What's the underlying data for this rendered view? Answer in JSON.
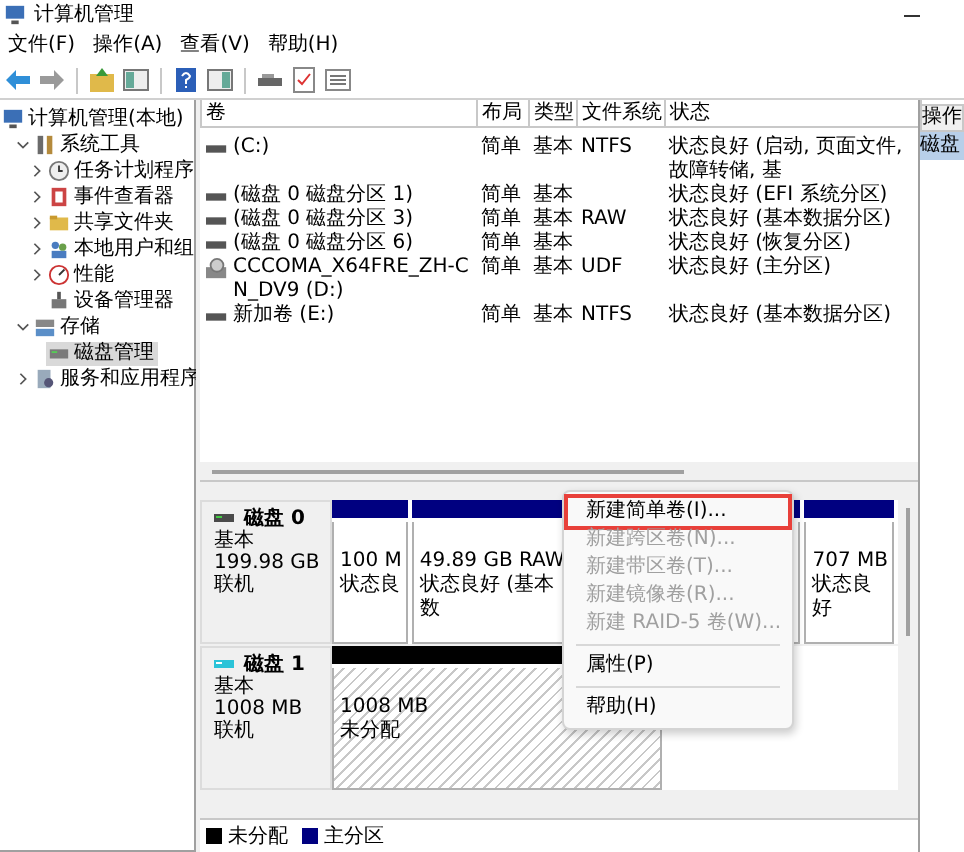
{
  "window": {
    "title": "计算机管理"
  },
  "menu": [
    "文件(F)",
    "操作(A)",
    "查看(V)",
    "帮助(H)"
  ],
  "tree": [
    {
      "label": "计算机管理(本地)",
      "selected": false,
      "children": [
        {
          "label": "系统工具",
          "selected": false,
          "expanded": true,
          "children": [
            {
              "label": "任务计划程序",
              "selected": false,
              "expanded": false
            },
            {
              "label": "事件查看器",
              "selected": false,
              "expanded": false
            },
            {
              "label": "共享文件夹",
              "selected": false,
              "expanded": false
            },
            {
              "label": "本地用户和组",
              "selected": false,
              "expanded": false
            },
            {
              "label": "性能",
              "selected": false,
              "expanded": false
            },
            {
              "label": "设备管理器",
              "selected": false
            }
          ]
        },
        {
          "label": "存储",
          "selected": false,
          "expanded": true,
          "children": [
            {
              "label": "磁盘管理",
              "selected": true
            }
          ]
        },
        {
          "label": "服务和应用程序",
          "selected": false,
          "expanded": false
        }
      ]
    }
  ],
  "table": {
    "columns": [
      "卷",
      "布局",
      "类型",
      "文件系统",
      "状态"
    ],
    "rows": [
      {
        "kind": "volume",
        "cells": [
          "(C:)",
          "简单",
          "基本",
          "NTFS",
          "状态良好 (启动, 页面文件, 故障转储, 基"
        ]
      },
      {
        "kind": "volume",
        "cells": [
          "(磁盘 0 磁盘分区 1)",
          "简单",
          "基本",
          "",
          "状态良好 (EFI 系统分区)"
        ]
      },
      {
        "kind": "volume",
        "cells": [
          "(磁盘 0 磁盘分区 3)",
          "简单",
          "基本",
          "RAW",
          "状态良好 (基本数据分区)"
        ]
      },
      {
        "kind": "volume",
        "cells": [
          "(磁盘 0 磁盘分区 6)",
          "简单",
          "基本",
          "",
          "状态良好 (恢复分区)"
        ]
      },
      {
        "kind": "optical",
        "cells": [
          "CCCOMA_X64FRE_ZH-CN_DV9 (D:)",
          "简单",
          "基本",
          "UDF",
          "状态良好 (主分区)"
        ]
      },
      {
        "kind": "volume",
        "cells": [
          "新加卷 (E:)",
          "简单",
          "基本",
          "NTFS",
          "状态良好 (基本数据分区)"
        ]
      }
    ]
  },
  "disks": [
    {
      "name": "磁盘 0",
      "kind": "basic",
      "type": "基本",
      "size": "199.98 GB",
      "status": "联机",
      "partitions": [
        {
          "kind": "primary",
          "size": "100 M",
          "status": "状态良"
        },
        {
          "kind": "primary",
          "size": "49.89 GB RAW",
          "status": "状态良好 (基本数"
        },
        {
          "kind": "primary",
          "size": "707 MB",
          "status": "状态良好"
        }
      ]
    },
    {
      "name": "磁盘 1",
      "kind": "removable",
      "type": "基本",
      "size": "1008 MB",
      "status": "联机",
      "partitions": [
        {
          "kind": "unallocated",
          "size": "1008 MB",
          "status": "未分配"
        }
      ]
    }
  ],
  "legend": [
    {
      "label": "未分配",
      "color": "#000000"
    },
    {
      "label": "主分区",
      "color": "#000080"
    }
  ],
  "context_menu": [
    {
      "kind": "item",
      "label": "新建简单卷(I)...",
      "disabled": false,
      "selected": true
    },
    {
      "kind": "item",
      "label": "新建跨区卷(N)...",
      "disabled": true,
      "selected": false
    },
    {
      "kind": "item",
      "label": "新建带区卷(T)...",
      "disabled": true,
      "selected": false
    },
    {
      "kind": "item",
      "label": "新建镜像卷(R)...",
      "disabled": true,
      "selected": false
    },
    {
      "kind": "item",
      "label": "新建 RAID-5 卷(W)...",
      "disabled": true,
      "selected": false
    },
    {
      "kind": "separator"
    },
    {
      "kind": "item",
      "label": "属性(P)",
      "disabled": false,
      "selected": false
    },
    {
      "kind": "separator"
    },
    {
      "kind": "item",
      "label": "帮助(H)",
      "disabled": false,
      "selected": false
    }
  ],
  "actions": {
    "title": "操作",
    "items": [
      {
        "label": "磁盘",
        "selected": true
      }
    ]
  }
}
